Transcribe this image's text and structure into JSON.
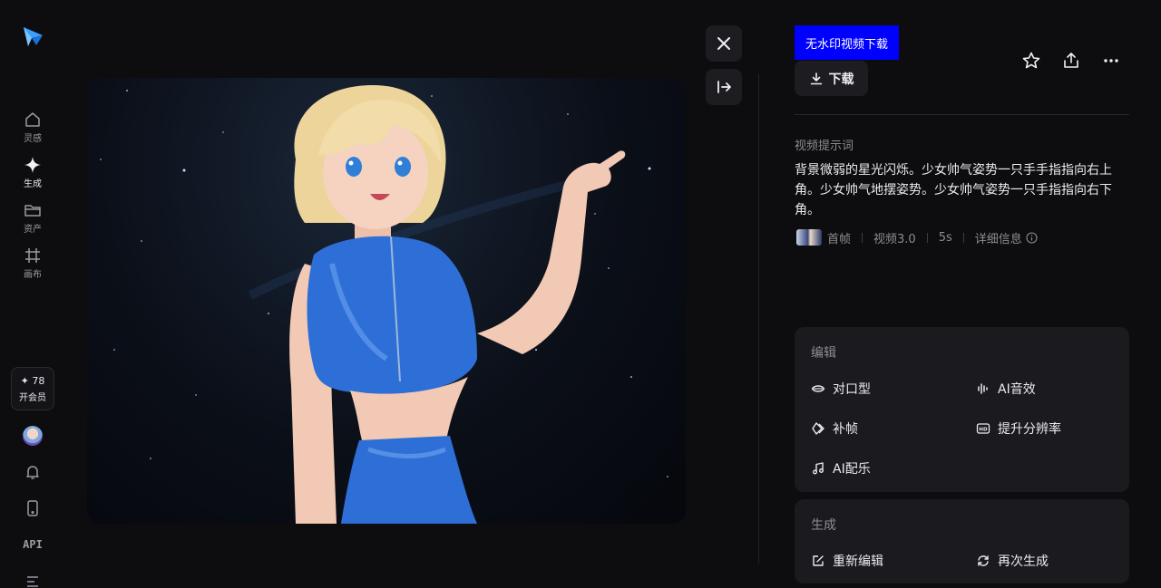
{
  "sidebar": {
    "items": [
      {
        "label": "灵感",
        "icon": "home-icon"
      },
      {
        "label": "生成",
        "icon": "sparkle-icon"
      },
      {
        "label": "资产",
        "icon": "folder-icon"
      },
      {
        "label": "画布",
        "icon": "canvas-icon"
      }
    ],
    "credits": {
      "value": "✦ 78",
      "label": "开会员"
    },
    "api_label": "API"
  },
  "viewer": {
    "close_icon": "close-icon",
    "collapse_icon": "arrow-right-bar-icon"
  },
  "panel": {
    "no_watermark_label": "无水印视频下载",
    "download_label": "下载",
    "prompt_title": "视频提示词",
    "prompt_text": "背景微弱的星光闪烁。少女帅气姿势一只手手指指向右上角。少女帅气地摆姿势。少女帅气姿势一只手指指向右下角。",
    "meta": {
      "frame_label": "首帧",
      "model": "视频3.0",
      "duration": "5s",
      "detail_label": "详细信息"
    },
    "edit_card": {
      "title": "编辑",
      "actions": [
        "对口型",
        "AI音效",
        "补帧",
        "提升分辨率",
        "AI配乐"
      ]
    },
    "generate_card": {
      "title": "生成",
      "actions": [
        "重新编辑",
        "再次生成"
      ]
    }
  },
  "colors": {
    "background": "#0d0d10",
    "card": "#1a1a1f",
    "accent_button": "#0000ff",
    "logo_blue": "#3aa0ff"
  }
}
